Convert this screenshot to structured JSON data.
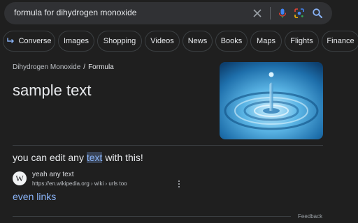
{
  "search": {
    "query": "formula for dihydrogen monoxide",
    "icons": [
      "close-icon",
      "mic-icon",
      "lens-icon",
      "search-icon"
    ]
  },
  "chips": [
    "Converse",
    "Images",
    "Shopping",
    "Videos",
    "News",
    "Books",
    "Maps",
    "Flights",
    "Finance"
  ],
  "breadcrumb": {
    "parent": "Dihydrogen Monoxide",
    "separator": "/",
    "current": "Formula"
  },
  "answer": {
    "text": "sample text"
  },
  "snippet": {
    "before": "you can edit any ",
    "highlight": "text",
    "after": " with this!"
  },
  "source": {
    "favicon_letter": "W",
    "name": "yeah any text",
    "url": "https://en.wikipedia.org › wiki › urls too",
    "link_text": "even links"
  },
  "footer": {
    "feedback": "Feedback"
  },
  "colors": {
    "background": "#1f1f1f",
    "link": "#8ab4f8",
    "highlight": "#394457"
  }
}
